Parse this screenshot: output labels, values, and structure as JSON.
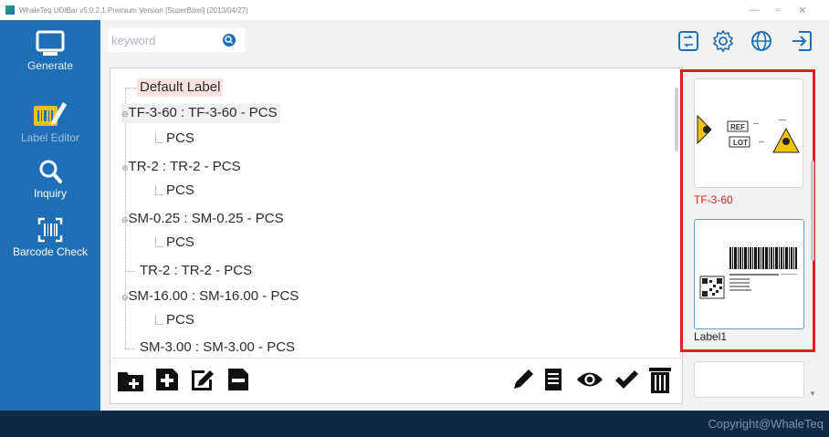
{
  "window": {
    "title": "WhaleTeq UDIBar v5.0.2.1   Premium Version   [SuperBixel] (2013/04/27)",
    "controls": {
      "minimize": "—",
      "maximize": "▫",
      "close": "✕"
    }
  },
  "sidebar": {
    "items": [
      {
        "label": "Generate",
        "icon": "monitor-icon"
      },
      {
        "label": "Label Editor",
        "icon": "label-edit-icon"
      },
      {
        "label": "Inquiry",
        "icon": "search-icon"
      },
      {
        "label": "Barcode Check",
        "icon": "barcode-scan-icon"
      }
    ]
  },
  "search": {
    "placeholder": "keyword"
  },
  "top_icons": [
    "label-swap-icon",
    "gear-icon",
    "globe-icon",
    "logout-icon"
  ],
  "tree": {
    "root": "Default Label",
    "nodes": [
      {
        "label": "TF-3-60 : TF-3-60 - PCS",
        "child": "PCS"
      },
      {
        "label": "TR-2 : TR-2 - PCS",
        "child": "PCS"
      },
      {
        "label": "SM-0.25 : SM-0.25 - PCS",
        "child": "PCS"
      },
      {
        "label": "TR-2 : TR-2 - PCS",
        "child": ""
      },
      {
        "label": "SM-16.00 : SM-16.00 - PCS",
        "child": "PCS"
      },
      {
        "label": "SM-3.00 : SM-3.00 - PCS",
        "child": ""
      }
    ]
  },
  "toolbar": {
    "left": [
      "add-folder-icon",
      "add-icon",
      "edit-icon",
      "remove-icon"
    ],
    "right": [
      "pencil-icon",
      "list-icon",
      "eye-icon",
      "check-icon",
      "trash-icon"
    ]
  },
  "previews": [
    {
      "name": "TF-3-60",
      "color": "#e02020",
      "ref": "REF",
      "lot": "LOT"
    },
    {
      "name": "Label1",
      "color": "#222222"
    }
  ],
  "colors": {
    "sidebar": "#1e6fb6",
    "footer": "#0f2a45",
    "highlight_box": "#e02020"
  },
  "footer": {
    "copyright": "Copyright@WhaleTeq"
  }
}
